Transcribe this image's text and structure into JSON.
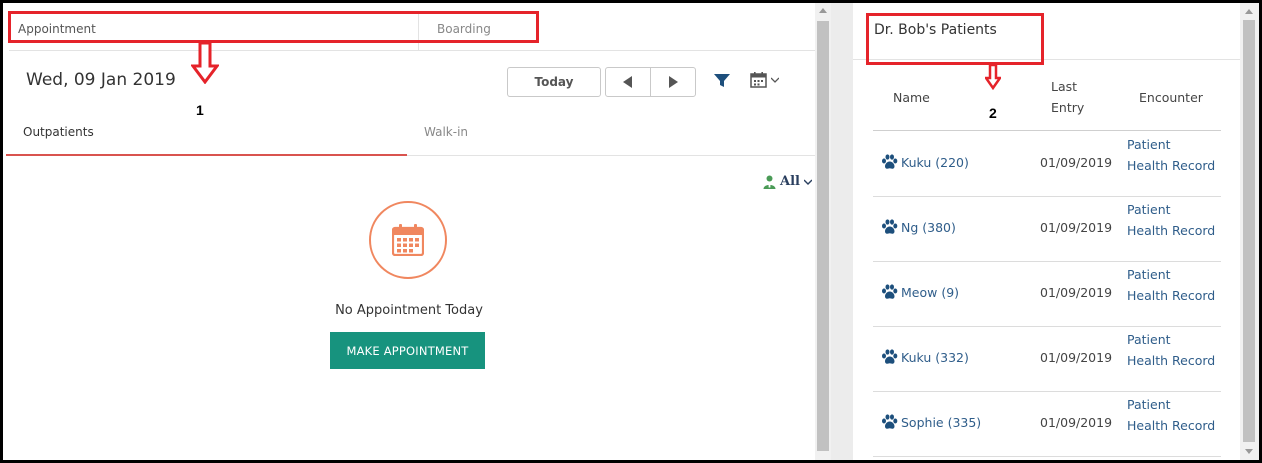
{
  "tabs": {
    "appointment": "Appointment",
    "boarding": "Boarding"
  },
  "header": {
    "date": "Wed, 09 Jan 2019",
    "today_label": "Today"
  },
  "icons": {
    "prev": "chevron-left-icon",
    "next": "chevron-right-icon",
    "filter": "filter-icon",
    "calendar": "calendar-icon",
    "vet": "doctor-icon",
    "paw": "paw-icon"
  },
  "subtabs": {
    "outpatients": "Outpatients",
    "walkin": "Walk-in"
  },
  "vet_filter": {
    "value": "All"
  },
  "empty_state": {
    "message": "No Appointment Today",
    "button_label": "MAKE APPOINTMENT"
  },
  "patients": {
    "title": "Dr. Bob's Patients",
    "columns": {
      "name": "Name",
      "last_entry_line1": "Last",
      "last_entry_line2": "Entry",
      "encounter": "Encounter"
    },
    "rows": [
      {
        "name": "Kuku (220)",
        "last_entry": "01/09/2019",
        "encounter_line1": "Patient",
        "encounter_line2": "Health Record"
      },
      {
        "name": "Ng (380)",
        "last_entry": "01/09/2019",
        "encounter_line1": "Patient",
        "encounter_line2": "Health Record"
      },
      {
        "name": "Meow (9)",
        "last_entry": "01/09/2019",
        "encounter_line1": "Patient",
        "encounter_line2": "Health Record"
      },
      {
        "name": "Kuku (332)",
        "last_entry": "01/09/2019",
        "encounter_line1": "Patient",
        "encounter_line2": "Health Record"
      },
      {
        "name": "Sophie (335)",
        "last_entry": "01/09/2019",
        "encounter_line1": "Patient",
        "encounter_line2": "Health Record"
      }
    ]
  },
  "annotations": {
    "label1": "1",
    "label2": "2"
  },
  "colors": {
    "annotation": "#e5232a",
    "accent_teal": "#17937e",
    "active_tab": "#d9534f",
    "link": "#2f5d8a",
    "empty_icon": "#f0875f"
  }
}
